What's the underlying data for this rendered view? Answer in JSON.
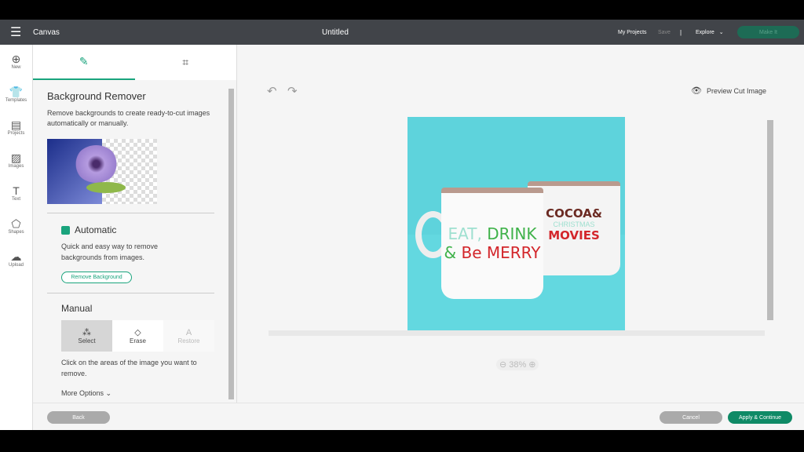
{
  "header": {
    "menu_icon": "hamburger-icon",
    "app": "Canvas",
    "title": "Untitled",
    "my_projects": "My Projects",
    "save": "Save",
    "separator": "|",
    "explore": "Explore",
    "make_it": "Make It"
  },
  "rail": [
    {
      "icon": "plus-icon",
      "label": "New"
    },
    {
      "icon": "shirt-icon",
      "label": "Templates"
    },
    {
      "icon": "book-icon",
      "label": "Projects"
    },
    {
      "icon": "image-icon",
      "label": "Images"
    },
    {
      "icon": "text-icon",
      "label": "Text"
    },
    {
      "icon": "shapes-icon",
      "label": "Shapes"
    },
    {
      "icon": "upload-icon",
      "label": "Upload"
    }
  ],
  "panel": {
    "tabs": [
      {
        "icon": "background-remover-icon"
      },
      {
        "icon": "crop-icon"
      }
    ],
    "title": "Background Remover",
    "description": "Remove backgrounds to create ready-to-cut images automatically or manually.",
    "automatic": {
      "title": "Automatic",
      "description": "Quick and easy way to remove backgrounds from images.",
      "button": "Remove Background"
    },
    "manual": {
      "title": "Manual",
      "tools": [
        {
          "label": "Select",
          "icon": "magic-wand-icon"
        },
        {
          "label": "Erase",
          "icon": "eraser-icon"
        },
        {
          "label": "Restore",
          "icon": "restore-icon"
        }
      ],
      "hint": "Click on the areas of the image you want to remove.",
      "more": "More Options"
    }
  },
  "canvas": {
    "preview": "Preview Cut Image",
    "zoom": "38%",
    "mug1_line1a": "EAT,",
    "mug1_line1b": "DRINK",
    "mug1_line2a": "&",
    "mug1_line2b": "Be MERRY",
    "mug2_line1": "COCOA&",
    "mug2_line2": "CHRISTMAS",
    "mug2_line3": "MOVIES"
  },
  "footer": {
    "back": "Back",
    "cancel": "Cancel",
    "apply": "Apply & Continue"
  },
  "colors": {
    "accent": "#1aa47d",
    "header": "#414449",
    "image_bg": "#5ed3dc"
  }
}
